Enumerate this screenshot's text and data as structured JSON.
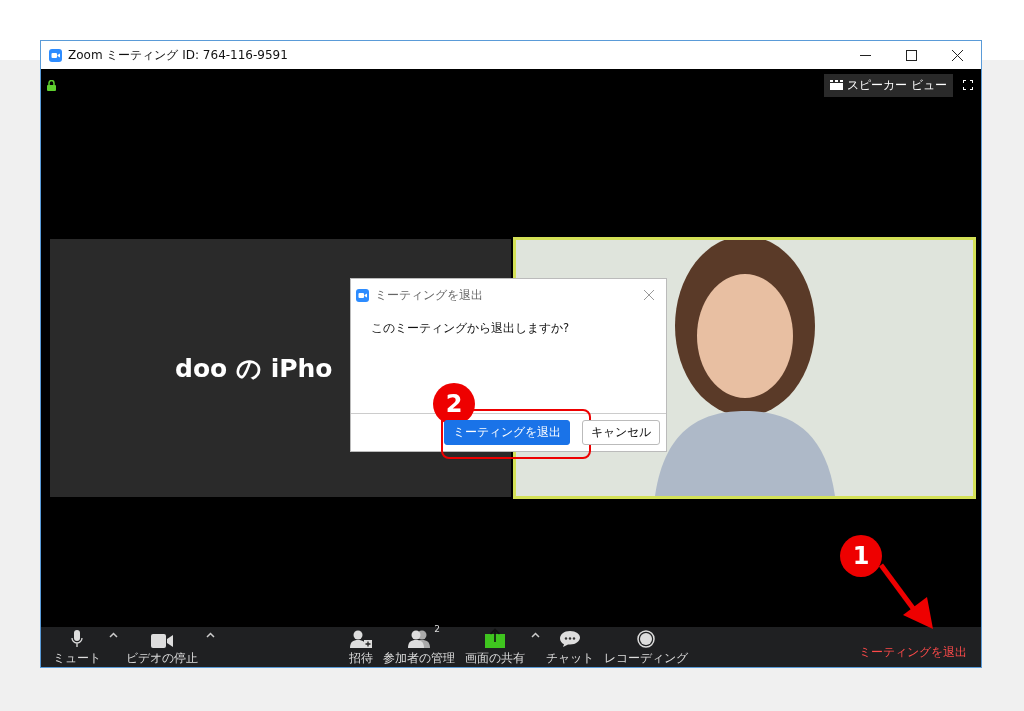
{
  "window": {
    "title": "Zoom ミーティング ID: 764-116-9591",
    "locked": true
  },
  "view_button": {
    "label": "スピーカー ビュー"
  },
  "tiles": [
    {
      "kind": "name",
      "label": "doo の iPho"
    },
    {
      "kind": "video",
      "highlighted": true
    }
  ],
  "dialog": {
    "step": "2",
    "title": "ミーティングを退出",
    "message": "このミーティングから退出しますか?",
    "buttons": [
      {
        "label": "ミーティングを退出",
        "primary": true
      },
      {
        "label": "キャンセル",
        "primary": false
      }
    ]
  },
  "toolbar": {
    "left": [
      {
        "kind": "mic",
        "label": "ミュート"
      },
      {
        "kind": "caret"
      },
      {
        "kind": "camera",
        "label": "ビデオの停止"
      },
      {
        "kind": "caret"
      }
    ],
    "center": [
      {
        "kind": "invite",
        "label": "招待"
      },
      {
        "kind": "participants",
        "label": "参加者の管理",
        "count": "2"
      },
      {
        "kind": "share",
        "label": "画面の共有"
      },
      {
        "kind": "caret"
      },
      {
        "kind": "chat",
        "label": "チャット"
      },
      {
        "kind": "record",
        "label": "レコーディング"
      }
    ],
    "leave": {
      "label": "ミーティングを退出",
      "step": "1"
    }
  }
}
